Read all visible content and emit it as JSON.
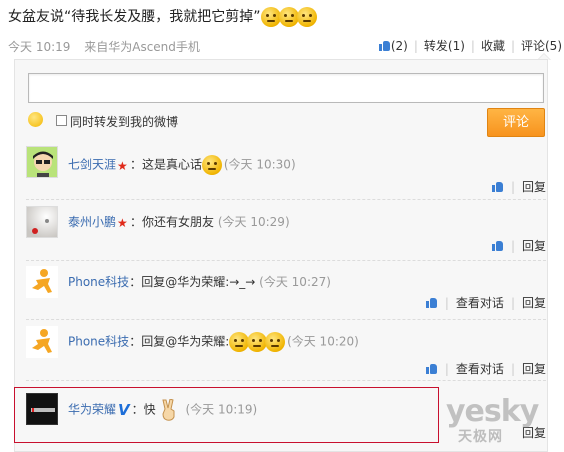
{
  "status": {
    "text_before": "女盆友说“待我长发及腰，我就把它剪掉”",
    "emoji_count": 3,
    "time": "今天 10:19",
    "source": "来自华为Ascend手机",
    "actions": {
      "like_count": "(2)",
      "forward": "转发(1)",
      "favorite": "收藏",
      "comment": "评论(5)"
    }
  },
  "composer": {
    "input_value": "",
    "forward_checkbox_label": "同时转发到我的微博",
    "submit_label": "评论"
  },
  "comments": [
    {
      "name": "七剑天涯",
      "badge": "star",
      "body": "：这是真心话",
      "emoji_after": 1,
      "time": "(今天 10:30)",
      "actions": [
        "回复"
      ]
    },
    {
      "name": "泰州小鹏",
      "badge": "star",
      "body": "：你还有女朋友",
      "emoji_after": 0,
      "time": "(今天 10:29)",
      "actions": [
        "回复"
      ]
    },
    {
      "name": "Phone科技",
      "badge": "",
      "body": "：回复@华为荣耀:→_→",
      "emoji_after": 0,
      "time": "(今天 10:27)",
      "actions": [
        "查看对话",
        "回复"
      ]
    },
    {
      "name": "Phone科技",
      "badge": "",
      "body": "：回复@华为荣耀:",
      "emoji_after": 3,
      "time": "(今天 10:20)",
      "actions": [
        "查看对话",
        "回复"
      ]
    },
    {
      "name": "华为荣耀",
      "badge": "V",
      "body": "：快",
      "emoji_after": 0,
      "time": "(今天 10:19)",
      "actions": [
        "回复"
      ]
    }
  ],
  "watermark": {
    "main": "yesky",
    "sub": "天极网"
  },
  "colors": {
    "accent_orange": "#f7931e",
    "link_blue": "#3b6cb0",
    "highlight_red": "#c8102e"
  }
}
